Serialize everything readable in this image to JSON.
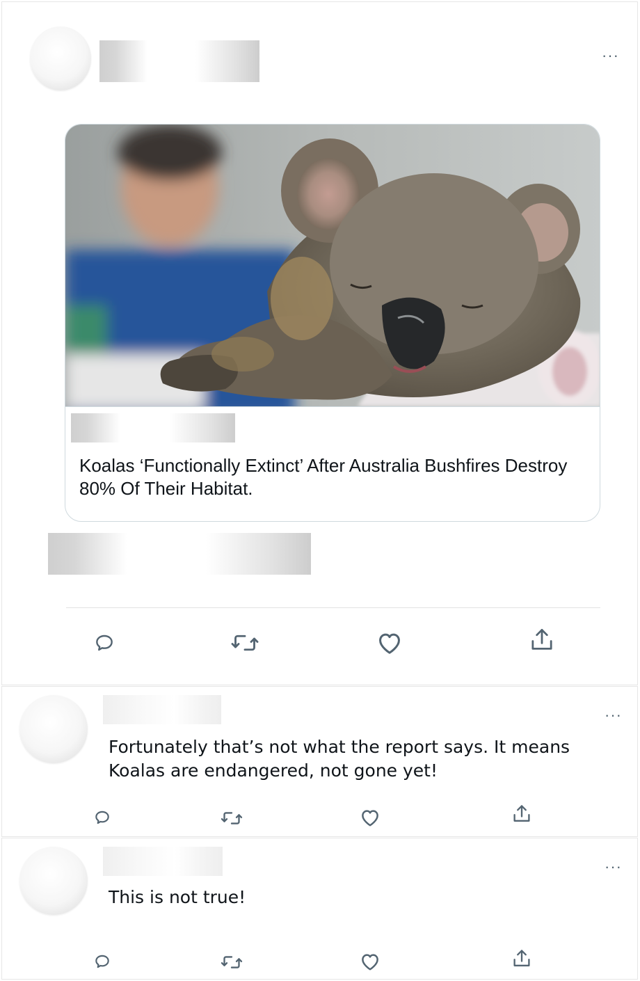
{
  "main_tweet": {
    "more_label": "···",
    "card": {
      "image_alt": "injured-koala-photo",
      "headline": "Koalas ‘Functionally Extinct’ After Australia Bushfires Destroy 80% Of Their Habitat."
    },
    "actions": {
      "reply_icon": "reply-icon",
      "retweet_icon": "retweet-icon",
      "like_icon": "heart-icon",
      "share_icon": "share-icon"
    }
  },
  "replies": [
    {
      "more_label": "···",
      "text": "Fortunately that’s not what the report says. It means Koalas are endangered, not gone yet!"
    },
    {
      "more_label": "···",
      "text": "This is not true!"
    }
  ],
  "colors": {
    "icon_gray": "#536471",
    "border": "#cfd9de",
    "text": "#0f1419"
  }
}
